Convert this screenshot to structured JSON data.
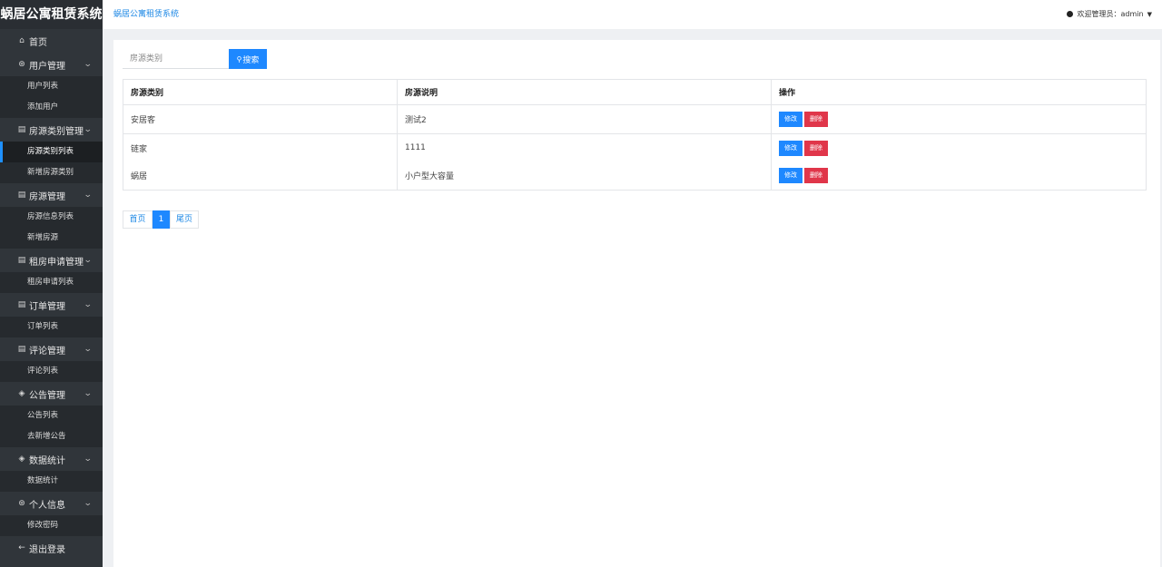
{
  "app": {
    "brand": "蜗居公寓租赁系统",
    "breadcrumb": "蜗居公寓租赁系统",
    "user_label": "欢迎管理员：admin",
    "accent_color": "#1e88ff",
    "danger_color": "#e0364a"
  },
  "sidebar": {
    "home": {
      "label": "首页",
      "icon": "home-icon"
    },
    "groups": [
      {
        "label": "用户管理",
        "icon": "user-icon",
        "items": [
          "用户列表",
          "添加用户"
        ]
      },
      {
        "label": "房源类别管理",
        "icon": "doc-icon",
        "items": [
          "房源类别列表",
          "新增房源类别"
        ]
      },
      {
        "label": "房源管理",
        "icon": "doc-icon",
        "items": [
          "房源信息列表",
          "新增房源"
        ]
      },
      {
        "label": "租房申请管理",
        "icon": "doc-icon",
        "items": [
          "租房申请列表"
        ]
      },
      {
        "label": "订单管理",
        "icon": "doc-icon",
        "items": [
          "订单列表"
        ]
      },
      {
        "label": "评论管理",
        "icon": "doc-icon",
        "items": [
          "评论列表"
        ]
      },
      {
        "label": "公告管理",
        "icon": "layers-icon",
        "items": [
          "公告列表",
          "去新增公告"
        ]
      },
      {
        "label": "数据统计",
        "icon": "layers-icon",
        "items": [
          "数据统计"
        ]
      },
      {
        "label": "个人信息",
        "icon": "user-icon",
        "items": [
          "修改密码"
        ]
      }
    ],
    "logout": {
      "label": "退出登录",
      "icon": "back-arrow-icon"
    }
  },
  "search": {
    "placeholder": "房源类别",
    "button_label": "搜索"
  },
  "table": {
    "headers": [
      "房源类别",
      "房源说明",
      "操作"
    ],
    "rows": [
      {
        "category": "安居客",
        "desc": "测试2"
      },
      {
        "category": "链家",
        "desc": "1111"
      },
      {
        "category": "蜗居",
        "desc": "小户型大容量"
      }
    ],
    "edit_label": "修改",
    "delete_label": "删除"
  },
  "pager": {
    "first": "首页",
    "current": "1",
    "last": "尾页"
  }
}
